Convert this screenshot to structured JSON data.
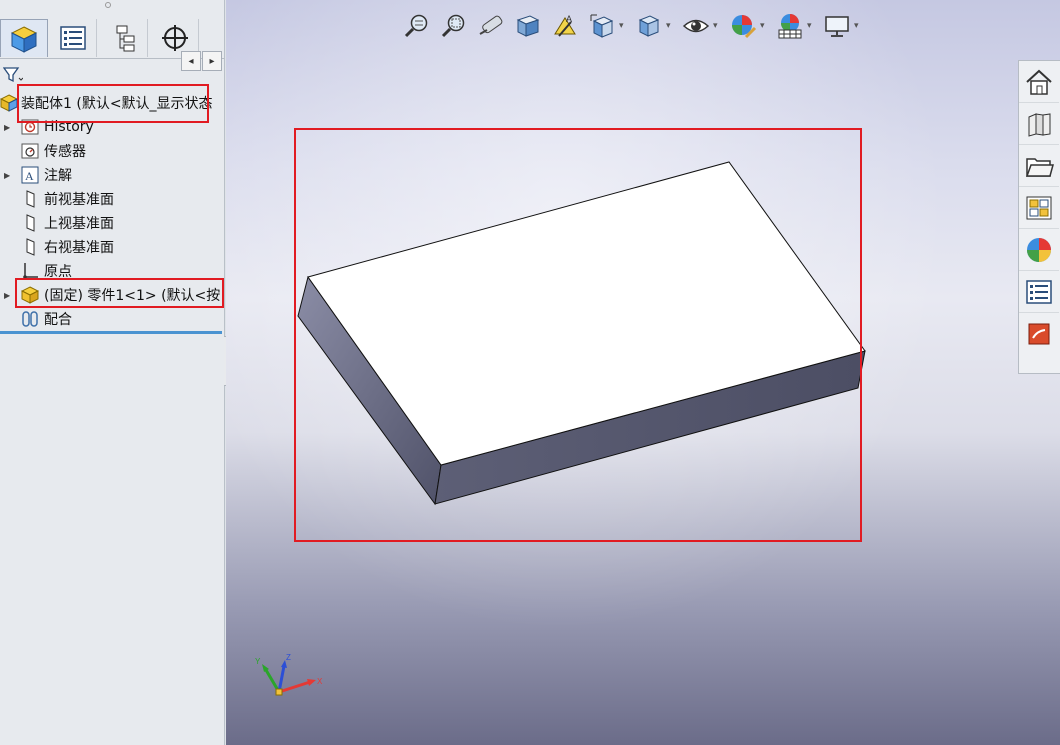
{
  "feature_tree": {
    "root_label": "装配体1  (默认<默认_显示状态",
    "items": [
      {
        "label": "History"
      },
      {
        "label": "传感器"
      },
      {
        "label": "注解"
      },
      {
        "label": "前视基准面"
      },
      {
        "label": "上视基准面"
      },
      {
        "label": "右视基准面"
      },
      {
        "label": "原点"
      },
      {
        "label": "(固定) 零件1<1> (默认<按"
      },
      {
        "label": "配合"
      }
    ]
  },
  "tab_arrows": {
    "left": "◂",
    "right": "▸"
  },
  "triad": {
    "x": "X",
    "y": "Y",
    "z": "Z"
  },
  "colors": {
    "highlight": "#e11b22",
    "tree_divider": "#4a93d1",
    "part_face_top": "#ffffff",
    "part_face_side": "#5d5f76"
  },
  "icons": {
    "tabs": [
      "feature-manager-icon",
      "property-manager-icon",
      "configuration-manager-icon",
      "dimxpert-icon"
    ],
    "heads_up": [
      "zoom-to-fit-icon",
      "zoom-to-area-icon",
      "previous-view-icon",
      "section-view-icon",
      "dynamic-annotation-icon",
      "view-orientation-icon",
      "display-style-icon",
      "hide-show-items-icon",
      "edit-appearance-icon",
      "apply-scene-icon",
      "view-settings-icon"
    ],
    "task_pane": [
      "solidworks-resources-icon",
      "design-library-icon",
      "file-explorer-icon",
      "view-palette-icon",
      "appearances-scenes-icon",
      "custom-properties-icon",
      "solidworks-forum-icon"
    ]
  }
}
